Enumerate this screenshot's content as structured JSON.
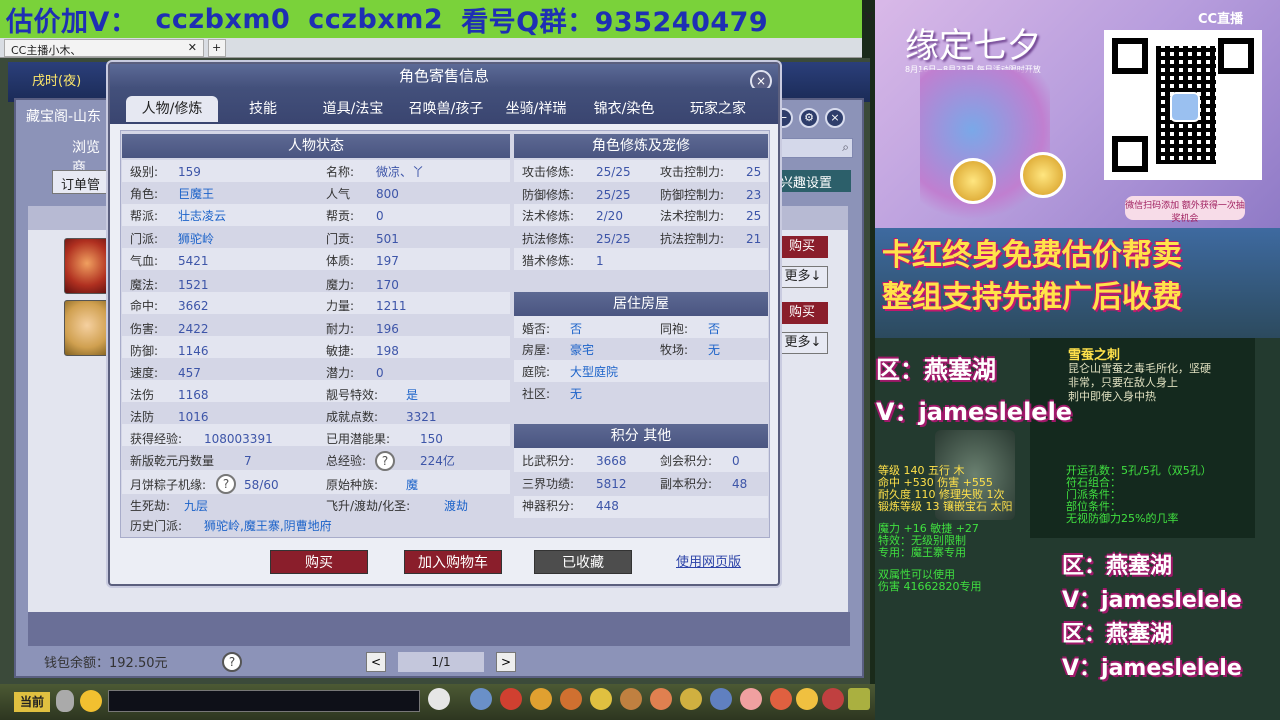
{
  "banner": {
    "segments": [
      "估价加V：",
      "cczbxm0",
      "cczbxm2",
      "看号Q群：935240479"
    ]
  },
  "browser": {
    "tab_label": "CC主播小木、"
  },
  "shop": {
    "title": "藏宝阁-山东",
    "browse_tab": "浏览商",
    "order_btn": "订单管",
    "interest_btn": "兴趣设置",
    "buy_label": "购买",
    "more_label": "更多↓",
    "wallet": "钱包余额：192.50元",
    "page": "1/1",
    "prev": "<",
    "next": ">",
    "help": "?"
  },
  "game_ui": {
    "time_label": "戌时(夜)",
    "current_tag": "当前"
  },
  "modal": {
    "title": "角色寄售信息",
    "close": "×",
    "tabs": [
      {
        "label": "人物/修炼",
        "active": true
      },
      {
        "label": "技能"
      },
      {
        "label": "道具/法宝"
      },
      {
        "label": "召唤兽/孩子"
      },
      {
        "label": "坐骑/祥瑞"
      },
      {
        "label": "锦衣/染色"
      },
      {
        "label": "玩家之家"
      }
    ],
    "sections": {
      "char_status": "人物状态",
      "cultivation": "角色修炼及宠修",
      "house": "居住房屋",
      "points": "积分 其他"
    },
    "left_col": [
      {
        "label": "级别:",
        "value": "159"
      },
      {
        "label": "角色:",
        "value": "巨魔王"
      },
      {
        "label": "帮派:",
        "value": "壮志凌云"
      },
      {
        "label": "门派:",
        "value": "狮驼岭"
      },
      {
        "label": "气血:",
        "value": "5421"
      },
      {
        "label": "魔法:",
        "value": "1521"
      },
      {
        "label": "命中:",
        "value": "3662"
      },
      {
        "label": "伤害:",
        "value": "2422"
      },
      {
        "label": "防御:",
        "value": "1146"
      },
      {
        "label": "速度:",
        "value": "457"
      },
      {
        "label": "法伤",
        "value": "1168"
      },
      {
        "label": "法防",
        "value": "1016"
      },
      {
        "label": "获得经验:",
        "value": "108003391"
      },
      {
        "label": "新版乾元丹数量",
        "value": "7"
      },
      {
        "label": "月饼粽子机缘:",
        "value": "58/60"
      },
      {
        "label": "生死劫:",
        "value": "九层"
      },
      {
        "label": "历史门派:",
        "value": "狮驼岭,魔王寨,阴曹地府"
      }
    ],
    "mid_col": [
      {
        "label": "名称:",
        "value": "微凉、丫"
      },
      {
        "label": "人气",
        "value": "800"
      },
      {
        "label": "帮贡:",
        "value": "0"
      },
      {
        "label": "门贡:",
        "value": "501"
      },
      {
        "label": "体质:",
        "value": "197"
      },
      {
        "label": "魔力:",
        "value": "170"
      },
      {
        "label": "力量:",
        "value": "1211"
      },
      {
        "label": "耐力:",
        "value": "196"
      },
      {
        "label": "敏捷:",
        "value": "198"
      },
      {
        "label": "潜力:",
        "value": "0"
      },
      {
        "label": "靓号特效:",
        "value": "是"
      },
      {
        "label": "成就点数:",
        "value": "3321"
      },
      {
        "label": "已用潜能果:",
        "value": "150"
      },
      {
        "label": "总经验:",
        "value": "224亿"
      },
      {
        "label": "原始种族:",
        "value": "魔"
      },
      {
        "label": "飞升/渡劫/化圣:",
        "value": "渡劫"
      }
    ],
    "cult_rows": [
      {
        "l1": "攻击修炼:",
        "v1": "25/25",
        "l2": "攻击控制力:",
        "v2": "25"
      },
      {
        "l1": "防御修炼:",
        "v1": "25/25",
        "l2": "防御控制力:",
        "v2": "23"
      },
      {
        "l1": "法术修炼:",
        "v1": "2/20",
        "l2": "法术控制力:",
        "v2": "25"
      },
      {
        "l1": "抗法修炼:",
        "v1": "25/25",
        "l2": "抗法控制力:",
        "v2": "21"
      },
      {
        "l1": "猎术修炼:",
        "v1": "1",
        "l2": "",
        "v2": ""
      }
    ],
    "house_rows": [
      {
        "l1": "婚否:",
        "v1": "否",
        "l2": "同袍:",
        "v2": "否"
      },
      {
        "l1": "房屋:",
        "v1": "豪宅",
        "l2": "牧场:",
        "v2": "无"
      },
      {
        "l1": "庭院:",
        "v1": "大型庭院",
        "l2": "",
        "v2": ""
      },
      {
        "l1": "社区:",
        "v1": "无",
        "l2": "",
        "v2": ""
      }
    ],
    "point_rows": [
      {
        "l1": "比武积分:",
        "v1": "3668",
        "l2": "剑会积分:",
        "v2": "0"
      },
      {
        "l1": "三界功绩:",
        "v1": "5812",
        "l2": "副本积分:",
        "v2": "48"
      },
      {
        "l1": "神器积分:",
        "v1": "448",
        "l2": "",
        "v2": ""
      }
    ],
    "buttons": {
      "buy": "购买",
      "add_cart": "加入购物车",
      "collected": "已收藏",
      "webpage": "使用网页版"
    },
    "qmark": "?"
  },
  "stream": {
    "promo_title": "缘定七夕",
    "promo_sub": "8月16日~8月23日 每日活动限时开放",
    "cc_logo": "CC直播",
    "qr_caption": "微信扫码添加 额外获得一次抽奖机会",
    "caption1": "卡红终身免费估价帮卖",
    "caption2": "整组支持先推广后收费",
    "overlay": [
      "区：燕塞湖",
      "V：jameslelele"
    ],
    "overlay_small": [
      "区：燕塞湖",
      "V：jameslelele",
      "区：燕塞湖",
      "V：jameslelele"
    ],
    "item": {
      "name": "雪蚕之刺",
      "lines": [
        "昆仑山雪蚕之毒毛所化，坚硬",
        "非常，只要在敌人身上",
        "刺中即使入身中热",
        "等级 140  五行 木",
        "命中 +530  伤害 +555",
        "耐久度 110  修理失败 1次",
        "锻炼等级 13  镶嵌宝石 太阳",
        "魔力 +16  敏捷 +27",
        "特效：无级别限制",
        "专用：魔王寨专用",
        "双属性可以使用",
        "伤害 41662820专用"
      ],
      "right_lines": [
        "开运孔数：5孔/5孔（双5孔）",
        "符石组合：",
        "门派条件：",
        "部位条件：",
        "无视防御力25%的几率"
      ]
    }
  }
}
